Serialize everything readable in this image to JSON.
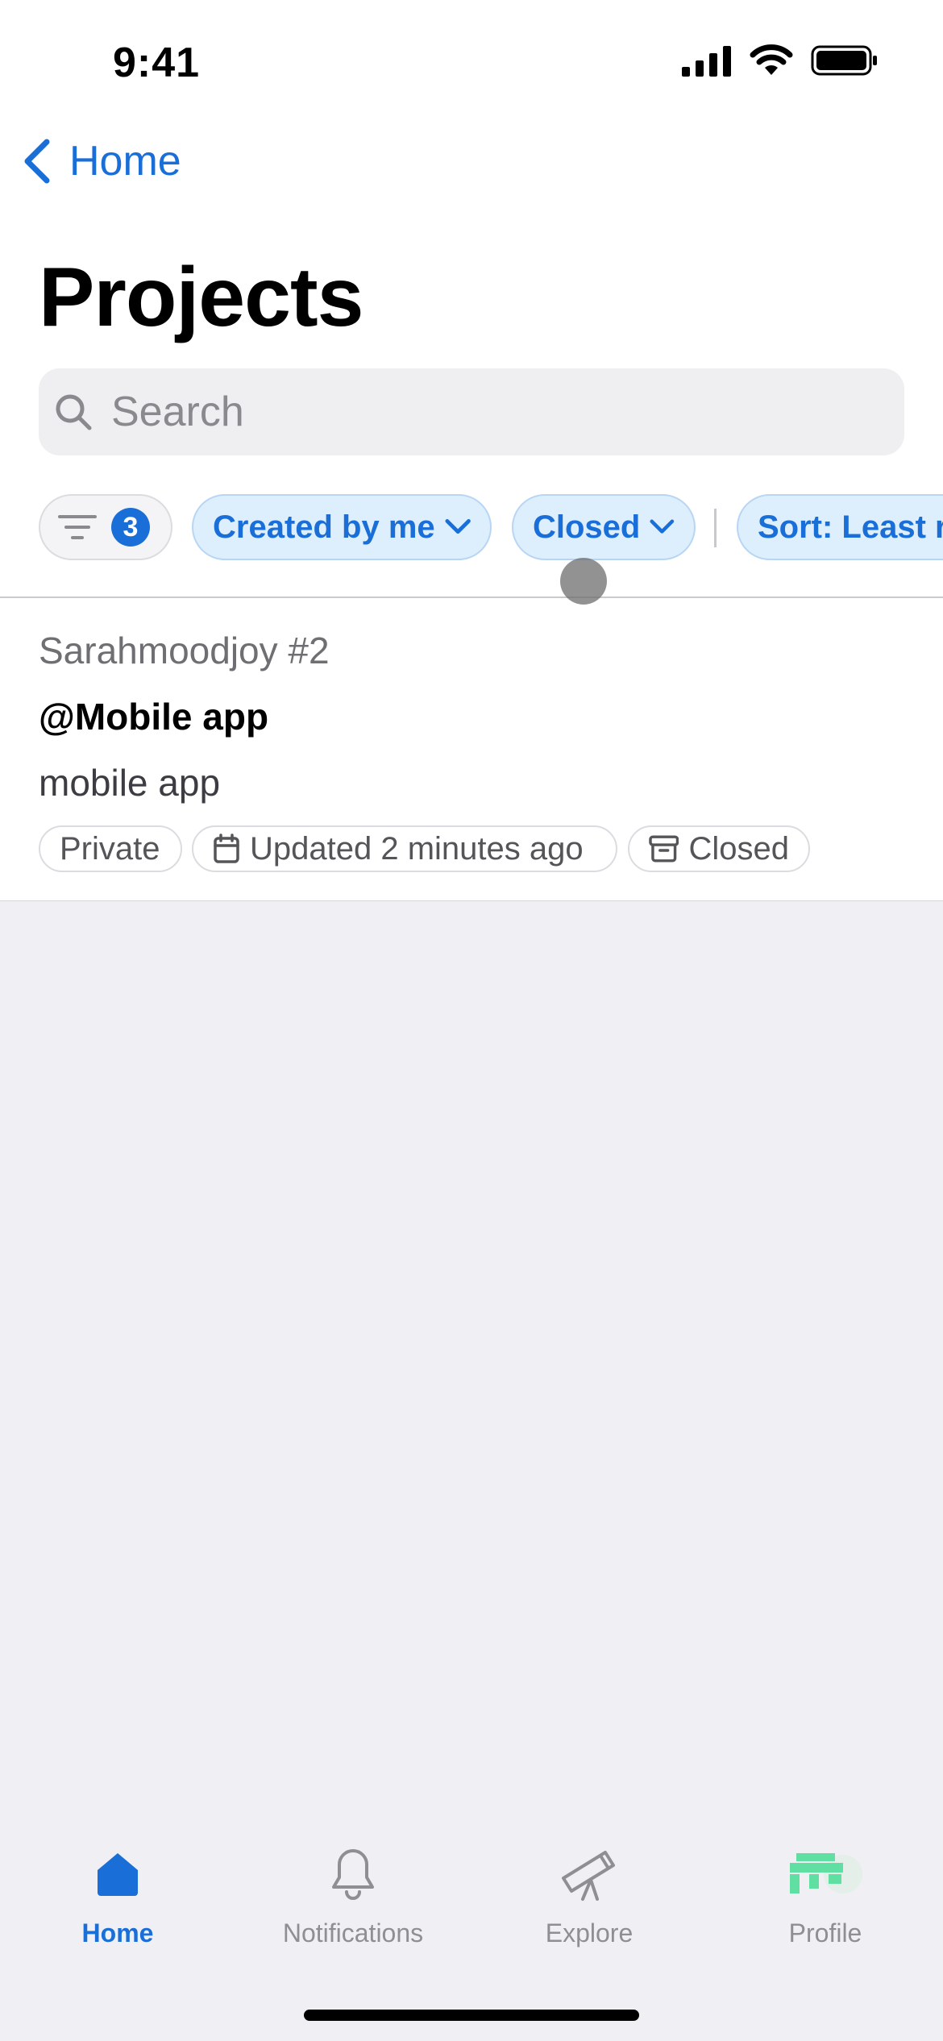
{
  "status_bar": {
    "time": "9:41"
  },
  "nav": {
    "back_label": "Home"
  },
  "page": {
    "title": "Projects"
  },
  "search": {
    "placeholder": "Search"
  },
  "filters": {
    "count_badge": "3",
    "created_by": "Created by me",
    "state": "Closed",
    "sort": "Sort: Least r"
  },
  "projects": [
    {
      "owner": "Sarahmoodjoy #2",
      "name": "@Mobile app",
      "description": "mobile app",
      "tags": {
        "visibility": "Private",
        "updated": "Updated 2 minutes ago",
        "state": "Closed"
      }
    }
  ],
  "tab_bar": {
    "home": "Home",
    "notifications": "Notifications",
    "explore": "Explore",
    "profile": "Profile"
  },
  "colors": {
    "accent": "#1a6ed8",
    "chip_bg": "#ddeefc",
    "background": "#efeff4"
  }
}
